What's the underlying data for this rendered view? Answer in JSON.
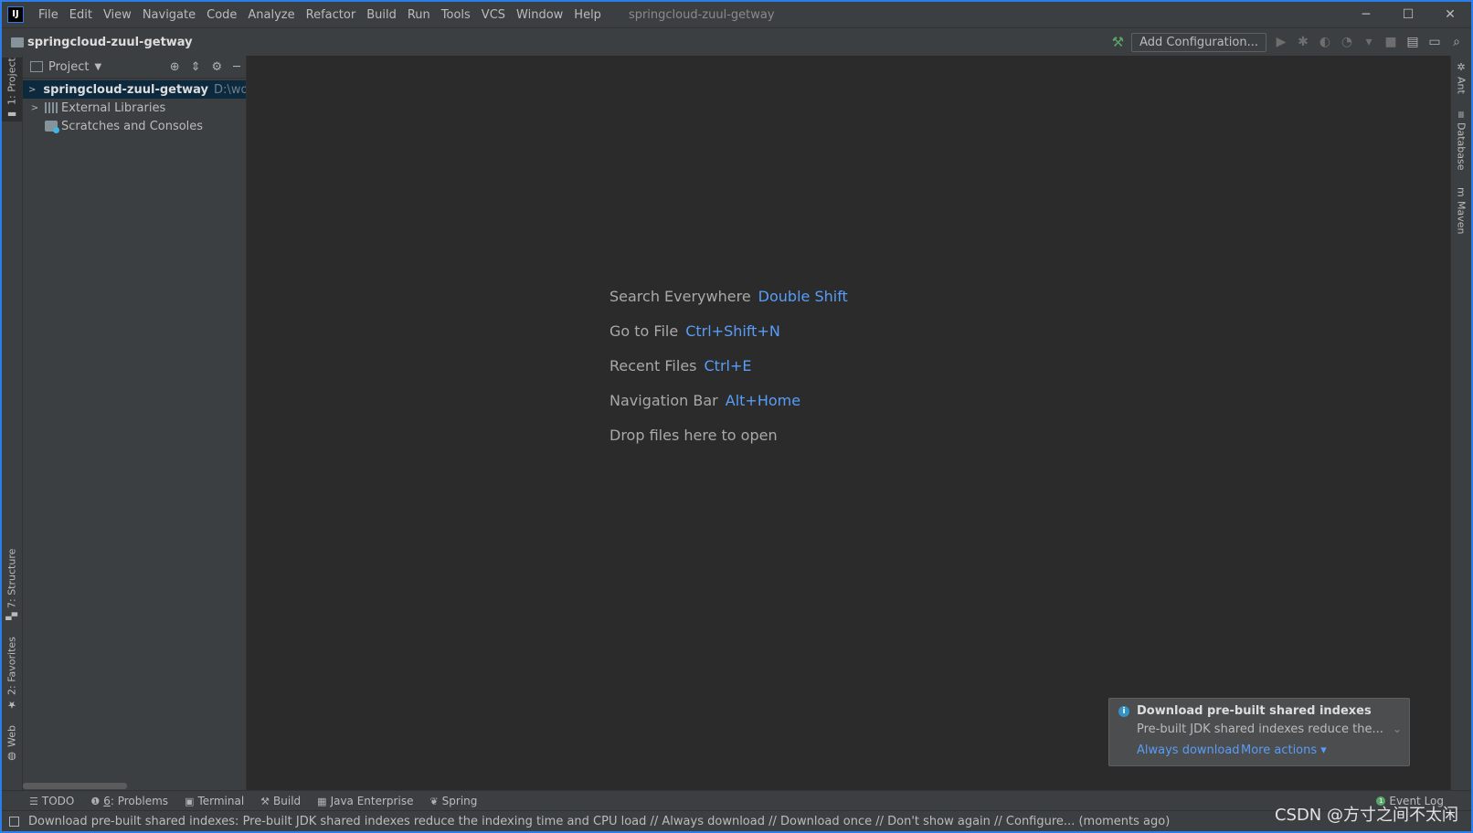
{
  "window": {
    "title": "springcloud-zuul-getway",
    "app_logo": "IJ",
    "controls": {
      "minimize": "─",
      "maximize": "☐",
      "close": "✕"
    }
  },
  "menu": [
    "File",
    "Edit",
    "View",
    "Navigate",
    "Code",
    "Analyze",
    "Refactor",
    "Build",
    "Run",
    "Tools",
    "VCS",
    "Window",
    "Help"
  ],
  "navbar": {
    "project": "springcloud-zuul-getway",
    "add_configuration": "Add Configuration..."
  },
  "left_strip": {
    "project_tab": "1: Project",
    "structure_tab": "7: Structure",
    "favorites_tab": "2: Favorites",
    "web_tab": "Web"
  },
  "right_strip": {
    "ant_tab": "Ant",
    "database_tab": "Database",
    "maven_tab": "Maven"
  },
  "project_panel": {
    "title": "Project",
    "tree": [
      {
        "label": "springcloud-zuul-getway",
        "path": "D:\\works"
      },
      {
        "label": "External Libraries"
      },
      {
        "label": "Scratches and Consoles"
      }
    ]
  },
  "editor_hints": [
    {
      "label": "Search Everywhere",
      "key": "Double Shift"
    },
    {
      "label": "Go to File",
      "key": "Ctrl+Shift+N"
    },
    {
      "label": "Recent Files",
      "key": "Ctrl+E"
    },
    {
      "label": "Navigation Bar",
      "key": "Alt+Home"
    },
    {
      "label": "Drop files here to open",
      "key": ""
    }
  ],
  "notification": {
    "title": "Download pre-built shared indexes",
    "text": "Pre-built JDK shared indexes reduce the...",
    "always_download": "Always download",
    "more_actions": "More actions ▾"
  },
  "bottom_tabs": {
    "todo": "TODO",
    "problems_num": "6",
    "problems": ": Problems",
    "terminal": "Terminal",
    "build": "Build",
    "java_enterprise": "Java Enterprise",
    "spring": "Spring",
    "event_log": "Event Log",
    "event_count": "1"
  },
  "status": {
    "text": "Download pre-built shared indexes: Pre-built JDK shared indexes reduce the indexing time and CPU load // Always download // Download once // Don't show again // Configure... (moments ago)"
  },
  "watermark": "CSDN @方寸之间不太闲"
}
